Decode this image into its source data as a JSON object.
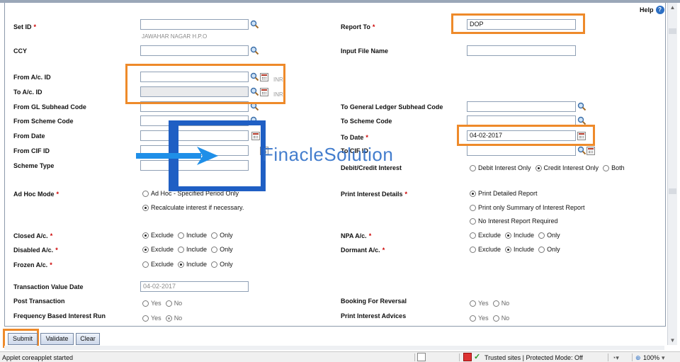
{
  "help": {
    "label": "Help",
    "icon": "help-icon"
  },
  "form": {
    "set_id": {
      "label": "Set ID",
      "value": "",
      "branch_name": "JAWAHAR NAGAR H.P.O"
    },
    "report_to": {
      "label": "Report To",
      "value": "DOP"
    },
    "ccy": {
      "label": "CCY",
      "value": ""
    },
    "input_file_name": {
      "label": "Input File Name",
      "value": ""
    },
    "from_ac_id": {
      "label": "From A/c. ID",
      "value": "",
      "currency": "INR"
    },
    "to_ac_id": {
      "label": "To A/c. ID",
      "value": "",
      "currency": "INR"
    },
    "from_gl_subhead_code": {
      "label": "From GL Subhead Code",
      "value": ""
    },
    "to_gl_subhead_code": {
      "label": "To General Ledger Subhead Code",
      "value": ""
    },
    "from_scheme_code": {
      "label": "From Scheme Code",
      "value": ""
    },
    "to_scheme_code": {
      "label": "To Scheme Code",
      "value": ""
    },
    "from_date": {
      "label": "From Date",
      "value": ""
    },
    "to_date": {
      "label": "To Date",
      "value": "04-02-2017"
    },
    "from_cif_id": {
      "label": "From CIF ID",
      "value": ""
    },
    "to_cif_id": {
      "label": "To CIF ID",
      "value": ""
    },
    "scheme_type": {
      "label": "Scheme Type",
      "value": ""
    },
    "debit_credit_interest": {
      "label": "Debit/Credit Interest",
      "options": [
        "Debit Interest Only",
        "Credit Interest Only",
        "Both"
      ],
      "selected": "Credit Interest Only"
    },
    "ad_hoc_mode": {
      "label": "Ad Hoc Mode",
      "options": [
        "Ad Hoc - Specified Period Only",
        "Recalculate interest if necessary."
      ],
      "selected": "Recalculate interest if necessary."
    },
    "print_interest_details": {
      "label": "Print Interest Details",
      "options": [
        "Print Detailed Report",
        "Print only Summary of Interest Report",
        "No Interest Report Required"
      ],
      "selected": "Print Detailed Report"
    },
    "closed_ac": {
      "label": "Closed A/c.",
      "options": [
        "Exclude",
        "Include",
        "Only"
      ],
      "selected": "Exclude"
    },
    "npa_ac": {
      "label": "NPA A/c.",
      "options": [
        "Exclude",
        "Include",
        "Only"
      ],
      "selected": "Include"
    },
    "disabled_ac": {
      "label": "Disabled A/c.",
      "options": [
        "Exclude",
        "Include",
        "Only"
      ],
      "selected": "Exclude"
    },
    "dormant_ac": {
      "label": "Dormant A/c.",
      "options": [
        "Exclude",
        "Include",
        "Only"
      ],
      "selected": "Include"
    },
    "frozen_ac": {
      "label": "Frozen A/c.",
      "options": [
        "Exclude",
        "Include",
        "Only"
      ],
      "selected": "Include"
    },
    "transaction_value_date": {
      "label": "Transaction Value Date",
      "value": "04-02-2017"
    },
    "post_transaction": {
      "label": "Post Transaction",
      "options": [
        "Yes",
        "No"
      ],
      "selected": ""
    },
    "booking_for_reversal": {
      "label": "Booking For Reversal",
      "options": [
        "Yes",
        "No"
      ],
      "selected": ""
    },
    "frequency_based_interest_run": {
      "label": "Frequency Based Interest Run",
      "options": [
        "Yes",
        "No"
      ],
      "selected": "No"
    },
    "print_interest_advices": {
      "label": "Print Interest Advices",
      "options": [
        "Yes",
        "No"
      ],
      "selected": ""
    }
  },
  "buttons": {
    "submit": "Submit",
    "validate": "Validate",
    "clear": "Clear"
  },
  "watermark": "FinacleSolution",
  "statusbar": {
    "message": "Applet coreapplet started",
    "zone": "Trusted sites | Protected Mode: Off",
    "zoom": "100%"
  },
  "colors": {
    "highlight": "#ee8a2a",
    "required": "#cc0000",
    "link_blue": "#2c6fc4"
  }
}
